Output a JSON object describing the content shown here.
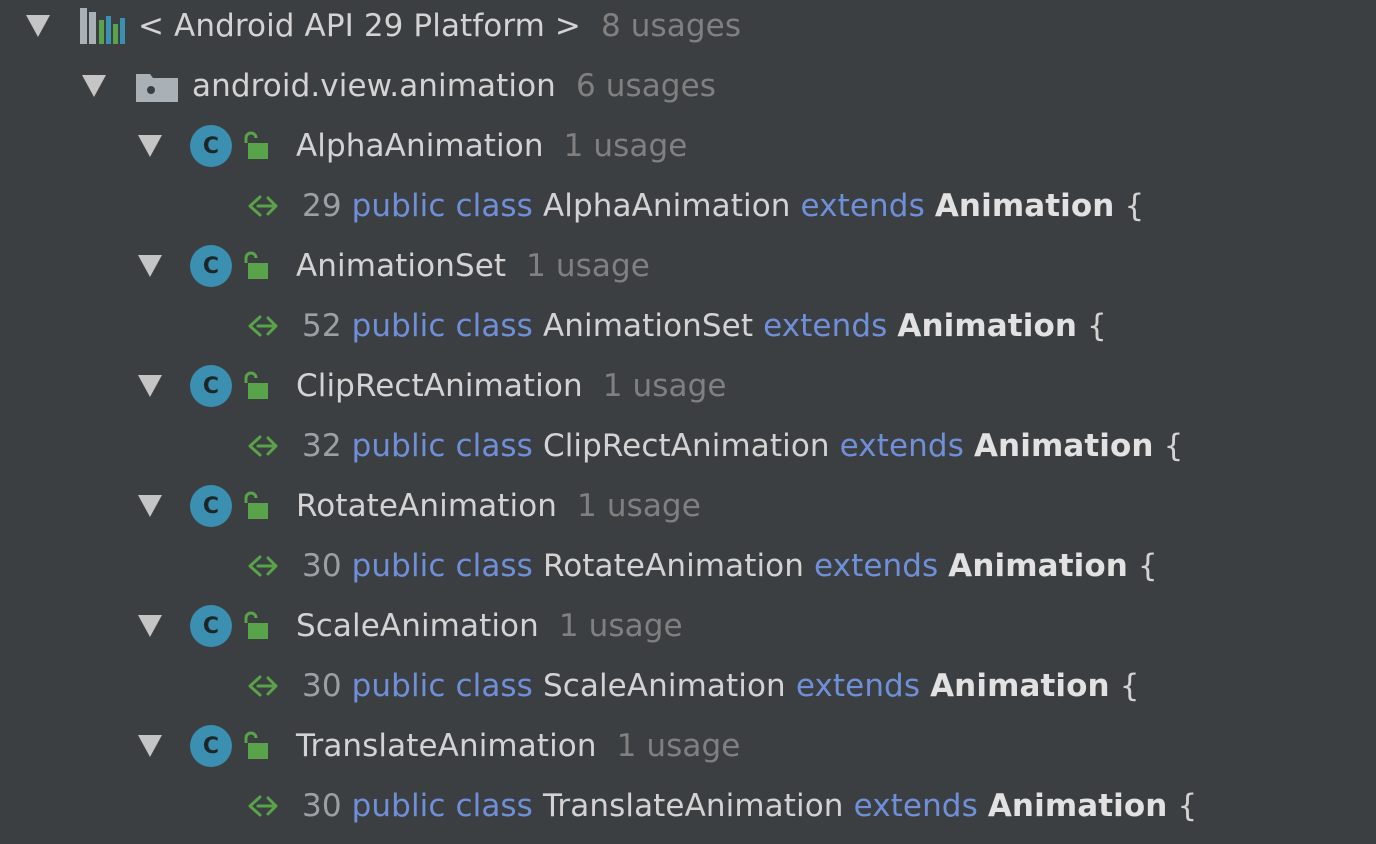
{
  "platform": {
    "label": "< Android API 29 Platform >",
    "count": "8 usages"
  },
  "package": {
    "label": "android.view.animation",
    "count": "6 usages"
  },
  "classes": [
    {
      "name": "AlphaAnimation",
      "count": "1 usage",
      "line": "29",
      "kw1": "public class",
      "decl_name": "AlphaAnimation",
      "kw2": "extends",
      "parent": "Animation",
      "brace": "{"
    },
    {
      "name": "AnimationSet",
      "count": "1 usage",
      "line": "52",
      "kw1": "public class",
      "decl_name": "AnimationSet",
      "kw2": "extends",
      "parent": "Animation",
      "brace": "{"
    },
    {
      "name": "ClipRectAnimation",
      "count": "1 usage",
      "line": "32",
      "kw1": "public class",
      "decl_name": "ClipRectAnimation",
      "kw2": "extends",
      "parent": "Animation",
      "brace": "{"
    },
    {
      "name": "RotateAnimation",
      "count": "1 usage",
      "line": "30",
      "kw1": "public class",
      "decl_name": "RotateAnimation",
      "kw2": "extends",
      "parent": "Animation",
      "brace": "{"
    },
    {
      "name": "ScaleAnimation",
      "count": "1 usage",
      "line": "30",
      "kw1": "public class",
      "decl_name": "ScaleAnimation",
      "kw2": "extends",
      "parent": "Animation",
      "brace": "{"
    },
    {
      "name": "TranslateAnimation",
      "count": "1 usage",
      "line": "30",
      "kw1": "public class",
      "decl_name": "TranslateAnimation",
      "kw2": "extends",
      "parent": "Animation",
      "brace": "{"
    }
  ],
  "icons": {
    "class_letter": "C"
  },
  "colors": {
    "background": "#3c3f41",
    "keyword": "#6f8fd8",
    "class_icon": "#3b8fb0",
    "green": "#59a34a"
  }
}
